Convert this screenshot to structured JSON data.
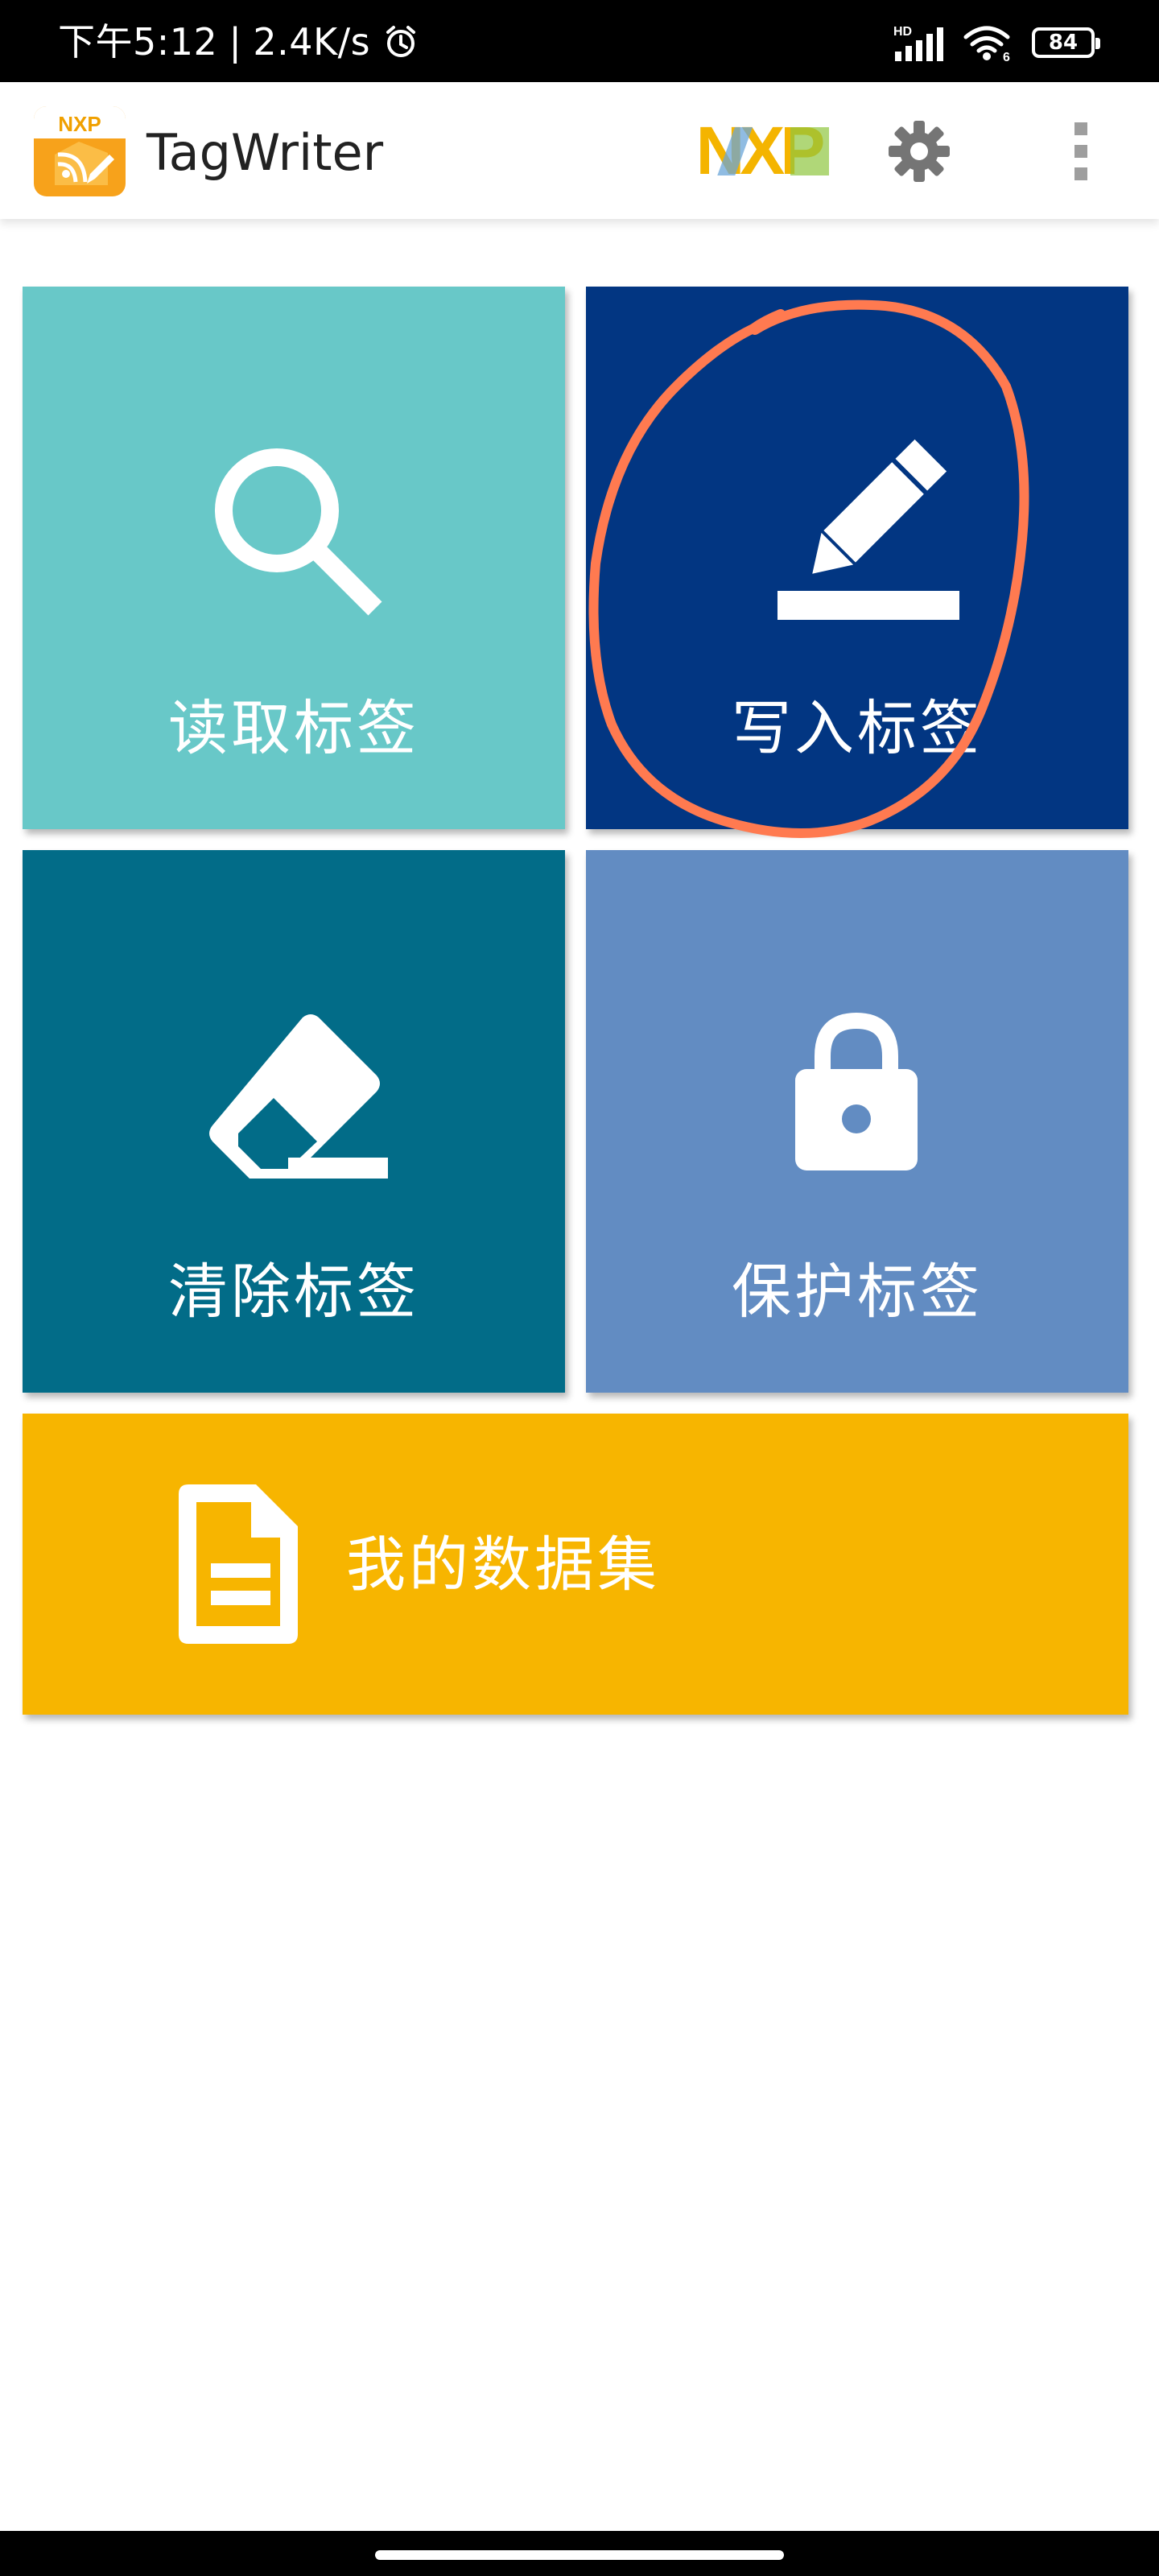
{
  "status_bar": {
    "time": "下午5:12",
    "separator": "|",
    "net_speed": "2.4K/s",
    "hd_badge": "HD",
    "wifi_badge": "6",
    "battery_level": "84",
    "icons": [
      "alarm-icon",
      "signal-icon",
      "wifi-icon",
      "battery-icon"
    ]
  },
  "app_bar": {
    "title": "TagWriter",
    "logo_text": "NXP",
    "brand_logo_text": "NXP",
    "actions": [
      "gear-icon",
      "more-vert-icon"
    ]
  },
  "tiles": {
    "read": {
      "label": "读取标签",
      "icon": "search-icon",
      "color": "#68c8c8"
    },
    "write": {
      "label": "写入标签",
      "icon": "pencil-icon",
      "color": "#023682"
    },
    "erase": {
      "label": "清除标签",
      "icon": "eraser-icon",
      "color": "#026c88"
    },
    "protect": {
      "label": "保护标签",
      "icon": "lock-icon",
      "color": "#628cc2"
    },
    "dataset": {
      "label": "我的数据集",
      "icon": "document-icon",
      "color": "#f7b500"
    }
  },
  "annotation": {
    "shape": "circle",
    "color": "#ff7a50",
    "target": "write-tag-tile"
  },
  "colors": {
    "status_bar": "#000000",
    "app_bar": "#ffffff",
    "background": "#ffffff"
  }
}
